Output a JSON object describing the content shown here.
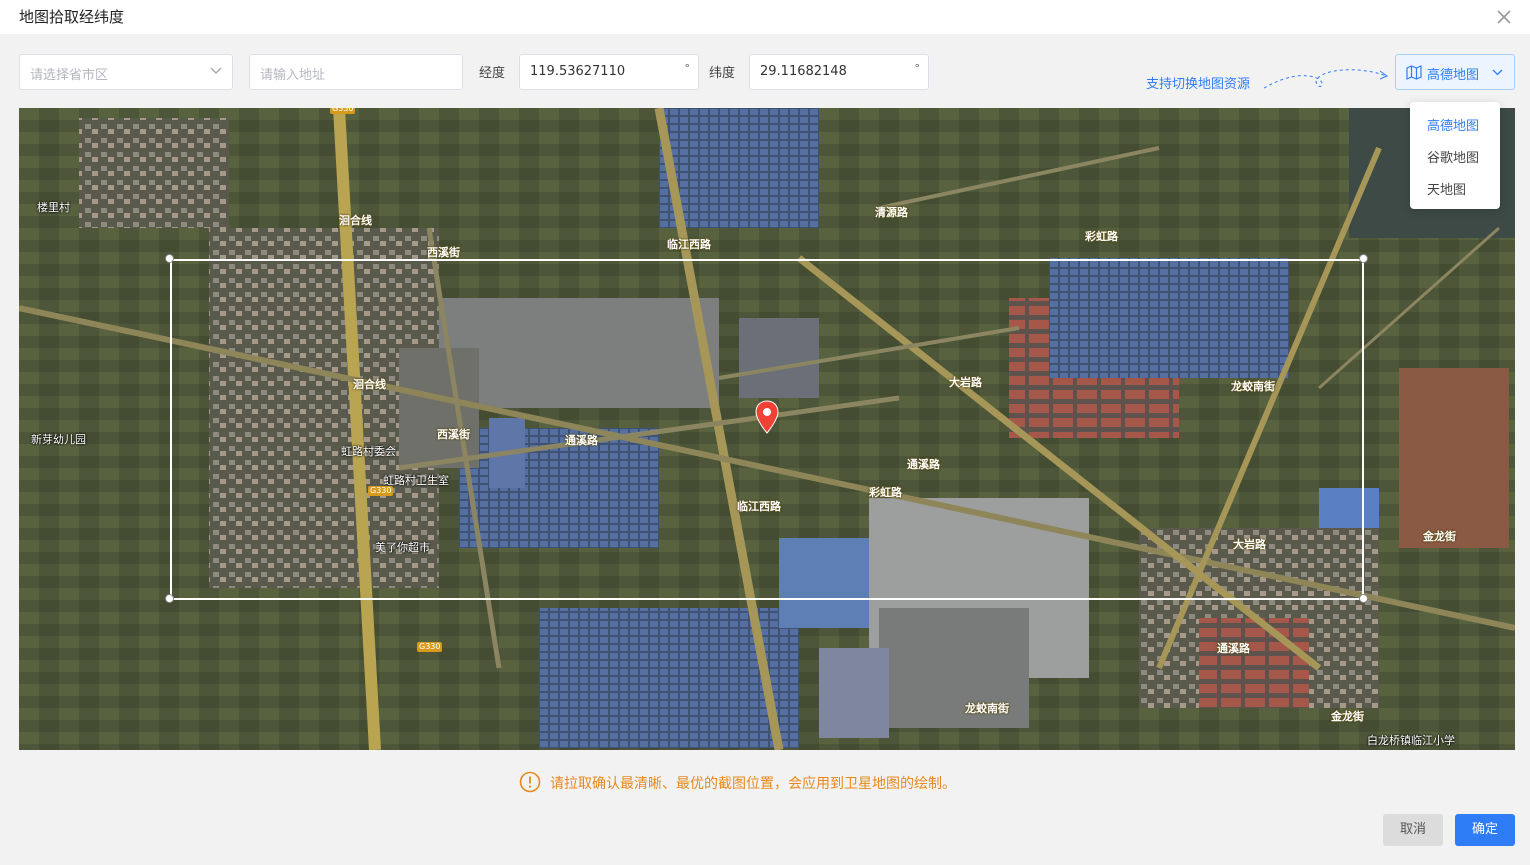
{
  "dialog": {
    "title": "地图拾取经纬度"
  },
  "toolbar": {
    "region_placeholder": "请选择省市区",
    "address_placeholder": "请输入地址",
    "lng_label": "经度",
    "lng_value": "119.53627110",
    "lat_label": "纬度",
    "lat_value": "29.11682148",
    "degree_unit": "°",
    "switch_hint": "支持切换地图资源",
    "map_source_selected": "高德地图"
  },
  "map_source_options": [
    "高德地图",
    "谷歌地图",
    "天地图"
  ],
  "map": {
    "place_labels": [
      "楼里村",
      "新芽幼儿园",
      "虹路村委会",
      "虹路村卫生室",
      "美了你超市",
      "白龙桥镇临江小学"
    ],
    "road_labels": [
      "洄合线",
      "西溪街",
      "临江西路",
      "清源路",
      "彩虹路",
      "大岩路",
      "龙蛟南街",
      "通溪路",
      "金龙街"
    ],
    "shield": "G330"
  },
  "notice": "请拉取确认最清晰、最优的截图位置，会应用到卫星地图的绘制。",
  "buttons": {
    "cancel": "取消",
    "ok": "确定"
  },
  "colors": {
    "accent": "#2f7df6",
    "warning": "#e8891d"
  }
}
